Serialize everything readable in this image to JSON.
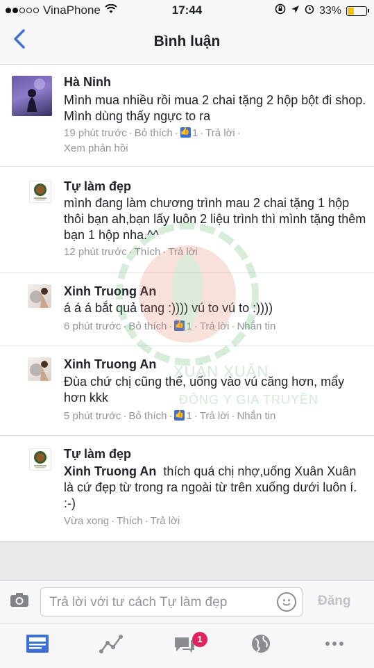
{
  "status_bar": {
    "carrier": "VinaPhone",
    "time": "17:44",
    "battery": "33%"
  },
  "nav": {
    "title": "Bình luận"
  },
  "comments": [
    {
      "name": "Hà Ninh",
      "text": "Mình mua nhiều rồi mua 2 chai tặng 2 hộp bột đi shop. Mình dùng thấy ngực to ra",
      "time": "19 phút trước",
      "like": "Bỏ thích",
      "like_count": "1",
      "reply": "Trả lời",
      "view_replies": "Xem phản hồi"
    },
    {
      "name": "Tự làm đẹp",
      "text": "mình đang làm chương trình mau 2 chai tặng 1 hộp thôi bạn ah,bạn lấy luôn 2 liệu trình thì mình tặng thêm bạn 1 hộp nha.^^",
      "time": "12 phút trước",
      "like": "Thích",
      "reply": "Trả lời"
    },
    {
      "name": "Xinh Truong An",
      "text": "á á á bắt quả tang :)))) vú to vú to :))))",
      "time": "6 phút trước",
      "like": "Bỏ thích",
      "like_count": "1",
      "reply": "Trả lời",
      "message": "Nhắn tin"
    },
    {
      "name": "Xinh Truong An",
      "text": "Đùa chứ chị cũng thế, uống vào vú căng hơn, mẩy hơn kkk",
      "time": "5 phút trước",
      "like": "Bỏ thích",
      "like_count": "1",
      "reply": "Trả lời",
      "message": "Nhắn tin"
    },
    {
      "name": "Tự làm đẹp",
      "mention": "Xinh Truong An",
      "text": "thích quá chị nhợ,uống Xuân Xuân là cứ đẹp từ trong ra ngoài từ trên xuống dưới luôn í. :-)",
      "time": "Vừa xong",
      "like": "Thích",
      "reply": "Trả lời"
    }
  ],
  "composer": {
    "placeholder": "Trả lời với tư cách Tự làm đẹp",
    "post": "Đăng"
  },
  "tabbar": {
    "notification_count": "1"
  },
  "watermark": {
    "line1": "XUÂN XUÂN",
    "line2": "ĐÔNG Y GIA TRUYỀN"
  },
  "colors": {
    "accent": "#3b6fd6",
    "badge": "#e0245e",
    "meta": "#90949c"
  }
}
